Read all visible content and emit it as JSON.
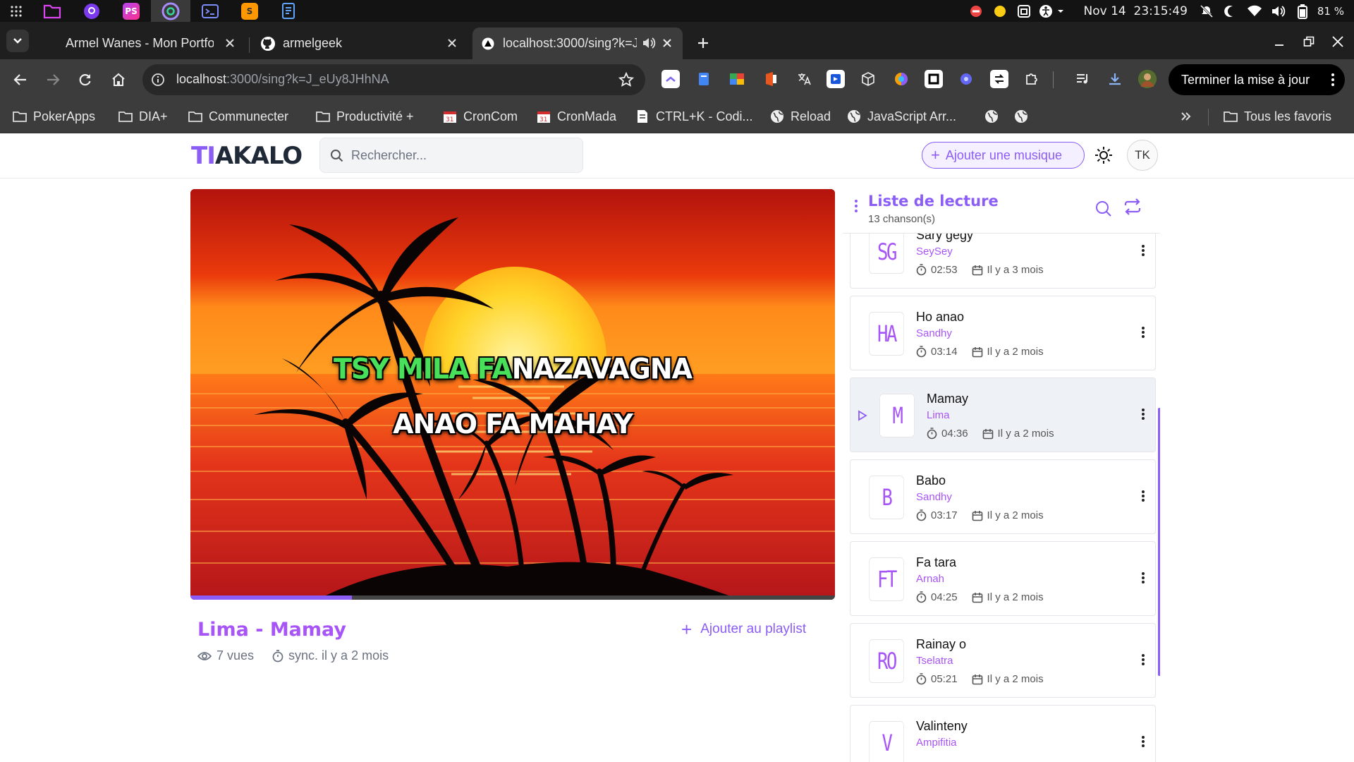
{
  "os": {
    "date": "Nov 14",
    "time": "23:15:49",
    "battery": "81 %",
    "apps": [
      "files-app",
      "github-desktop-app",
      "phpstorm-app",
      "chrome-app",
      "terminal-app",
      "sublime-app",
      "editor-app"
    ]
  },
  "browser": {
    "tabs": [
      {
        "title": "Armel Wanes - Mon Portfolio",
        "active": false
      },
      {
        "title": "armelgeek",
        "active": false
      },
      {
        "title": "localhost:3000/sing?k=J_eUy8JHhNA",
        "active": true,
        "audio": true
      }
    ],
    "url": {
      "host": "localhost",
      "rest": ":3000/sing?k=J_eUy8JHhNA"
    },
    "update_button": "Terminer la mise à jour",
    "bookmarks": [
      {
        "label": "PokerApps",
        "icon": "folder-icon"
      },
      {
        "label": "DIA+",
        "icon": "folder-icon"
      },
      {
        "label": "Communecter",
        "icon": "folder-icon"
      },
      {
        "label": "Productivité +",
        "icon": "folder-icon"
      },
      {
        "label": "CronCom",
        "icon": "calendar-icon"
      },
      {
        "label": "CronMada",
        "icon": "calendar-icon"
      },
      {
        "label": "CTRL+K - Codi...",
        "icon": "page-icon"
      },
      {
        "label": "Reload",
        "icon": "globe-icon"
      },
      {
        "label": "JavaScript Arr...",
        "icon": "globe-icon"
      }
    ],
    "all_bookmarks": "Tous les favoris"
  },
  "app": {
    "logo_part1": "TI",
    "logo_part2": "AKALO",
    "search_placeholder": "Rechercher...",
    "add_music": "Ajouter une musique",
    "avatar": "TK",
    "accent": "#8b5cf6"
  },
  "player": {
    "lyric_line1_sung": "TSY MILA FA",
    "lyric_line1_rest": "NAZAVAGNA",
    "lyric_line2": "ANAO FA MAHAY",
    "progress": 0.25,
    "title": "Lima - Mamay",
    "views": "7 vues",
    "sync": "sync. il y a 2 mois",
    "add_to_playlist": "Ajouter au playlist"
  },
  "playlist": {
    "title": "Liste de lecture",
    "count": "13 chanson(s)",
    "items": [
      {
        "initials": "SG",
        "name": "Sary gegy",
        "artist": "SeySey",
        "duration": "02:53",
        "date": "Il y a 3 mois",
        "current": false
      },
      {
        "initials": "HA",
        "name": "Ho anao",
        "artist": "Sandhy",
        "duration": "03:14",
        "date": "Il y a 2 mois",
        "current": false
      },
      {
        "initials": "M",
        "name": "Mamay",
        "artist": "Lima",
        "duration": "04:36",
        "date": "Il y a 2 mois",
        "current": true
      },
      {
        "initials": "B",
        "name": "Babo",
        "artist": "Sandhy",
        "duration": "03:17",
        "date": "Il y a 2 mois",
        "current": false
      },
      {
        "initials": "FT",
        "name": "Fa tara",
        "artist": "Arnah",
        "duration": "04:25",
        "date": "Il y a 2 mois",
        "current": false
      },
      {
        "initials": "RO",
        "name": "Rainay o",
        "artist": "Tselatra",
        "duration": "05:21",
        "date": "Il y a 2 mois",
        "current": false
      },
      {
        "initials": "V",
        "name": "Valinteny",
        "artist": "Ampifitia",
        "duration": "",
        "date": "",
        "current": false
      }
    ]
  }
}
